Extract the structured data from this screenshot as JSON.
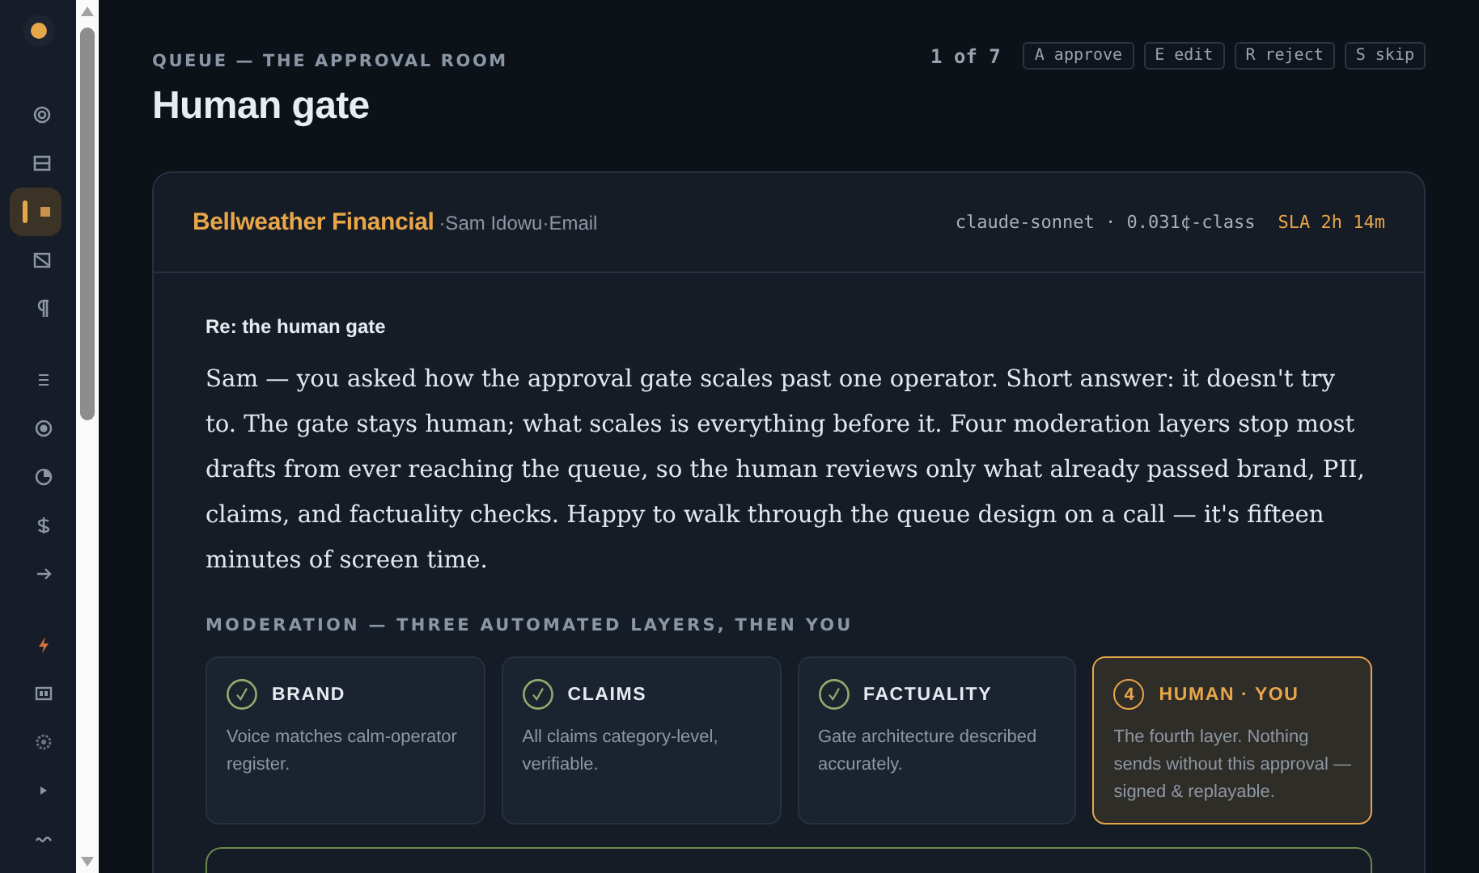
{
  "sidebar": {
    "groups": [
      {
        "items": [
          {
            "selected": false
          },
          {
            "selected": false
          },
          {
            "selected": true
          },
          {
            "selected": false
          },
          {
            "selected": false
          }
        ]
      },
      {
        "items": [
          {
            "selected": false
          },
          {
            "selected": false
          },
          {
            "selected": false
          },
          {
            "selected": false
          },
          {
            "selected": false
          }
        ]
      },
      {
        "items": [
          {
            "selected": false
          },
          {
            "selected": false
          },
          {
            "selected": false
          },
          {
            "selected": false
          },
          {
            "selected": false
          }
        ]
      }
    ]
  },
  "header": {
    "eyebrow": "QUEUE — THE APPROVAL ROOM",
    "title": "Human gate",
    "position": "1 of 7",
    "shortcuts": [
      {
        "key": "A",
        "label": "approve"
      },
      {
        "key": "E",
        "label": "edit"
      },
      {
        "key": "R",
        "label": "reject"
      },
      {
        "key": "S",
        "label": "skip"
      }
    ]
  },
  "draft": {
    "client": "Bellweather Financial",
    "byline": "·Sam Idowu·Email",
    "model": "claude-sonnet · 0.031¢-class",
    "sla": "SLA 2h 14m",
    "subject": "Re: the human gate",
    "body": "Sam — you asked how the approval gate scales past one operator. Short answer: it doesn't try to. The gate stays human; what scales is everything before it. Four moderation layers stop most drafts from ever reaching the queue, so the human reviews only what already passed brand, PII, claims, and factuality checks. Happy to walk through the queue design on a call — it's fifteen minutes of screen time.",
    "moderation": {
      "heading": "MODERATION — THREE AUTOMATED LAYERS, THEN YOU",
      "layers": [
        {
          "kind": "passed",
          "name": "BRAND",
          "note": "Voice matches calm-operator register."
        },
        {
          "kind": "passed",
          "name": "CLAIMS",
          "note": "All claims category-level, verifiable."
        },
        {
          "kind": "passed",
          "name": "FACTUALITY",
          "note": "Gate architecture described accurately."
        },
        {
          "kind": "current",
          "marker": "4",
          "name": "HUMAN · YOU",
          "note": "The fourth layer. Nothing sends without this approval — signed & replayable."
        }
      ]
    }
  }
}
